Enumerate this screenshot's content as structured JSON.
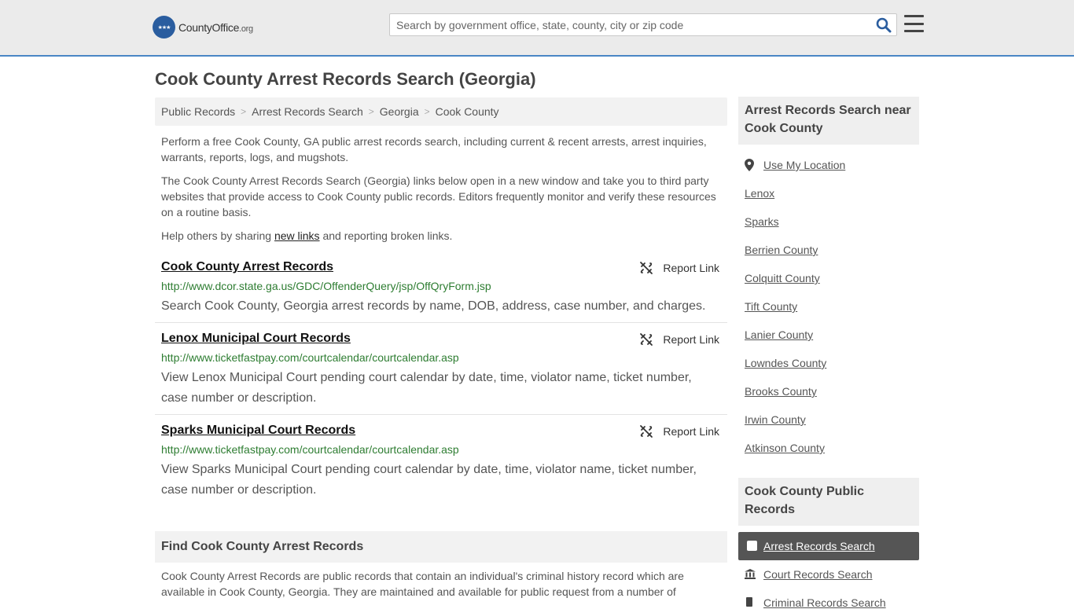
{
  "header": {
    "logo_mark": "★★★",
    "logo_name": "CountyOffice",
    "logo_tld": ".org",
    "search_placeholder": "Search by government office, state, county, city or zip code"
  },
  "page_title": "Cook County Arrest Records Search (Georgia)",
  "breadcrumb": [
    "Public Records",
    "Arrest Records Search",
    "Georgia",
    "Cook County"
  ],
  "intro": {
    "p1": "Perform a free Cook County, GA public arrest records search, including current & recent arrests, arrest inquiries, warrants, reports, logs, and mugshots.",
    "p2": "The Cook County Arrest Records Search (Georgia) links below open in a new window and take you to third party websites that provide access to Cook County public records. Editors frequently monitor and verify these resources on a routine basis.",
    "p3_before": "Help others by sharing ",
    "p3_link": "new links",
    "p3_after": " and reporting broken links."
  },
  "report_label": "Report Link",
  "records": [
    {
      "title": "Cook County Arrest Records",
      "url": "http://www.dcor.state.ga.us/GDC/OffenderQuery/jsp/OffQryForm.jsp",
      "desc": "Search Cook County, Georgia arrest records by name, DOB, address, case number, and charges."
    },
    {
      "title": "Lenox Municipal Court Records",
      "url": "http://www.ticketfastpay.com/courtcalendar/courtcalendar.asp",
      "desc": "View Lenox Municipal Court pending court calendar by date, time, violator name, ticket number, case number or description."
    },
    {
      "title": "Sparks Municipal Court Records",
      "url": "http://www.ticketfastpay.com/courtcalendar/courtcalendar.asp",
      "desc": "View Sparks Municipal Court pending court calendar by date, time, violator name, ticket number, case number or description."
    }
  ],
  "find": {
    "title": "Find Cook County Arrest Records",
    "text": "Cook County Arrest Records are public records that contain an individual's criminal history record which are available in Cook County, Georgia. They are maintained and available for public request from a number of"
  },
  "sidebar": {
    "near_title": "Arrest Records Search near Cook County",
    "use_location": "Use My Location",
    "near_links": [
      "Lenox",
      "Sparks",
      "Berrien County",
      "Colquitt County",
      "Tift County",
      "Lanier County",
      "Lowndes County",
      "Brooks County",
      "Irwin County",
      "Atkinson County"
    ],
    "public_title": "Cook County Public Records",
    "public_links": [
      "Arrest Records Search",
      "Court Records Search",
      "Criminal Records Search"
    ]
  },
  "colors": {
    "accent_border": "#4a86c5",
    "url_green": "#2e7d32",
    "active_bg": "#555555"
  }
}
